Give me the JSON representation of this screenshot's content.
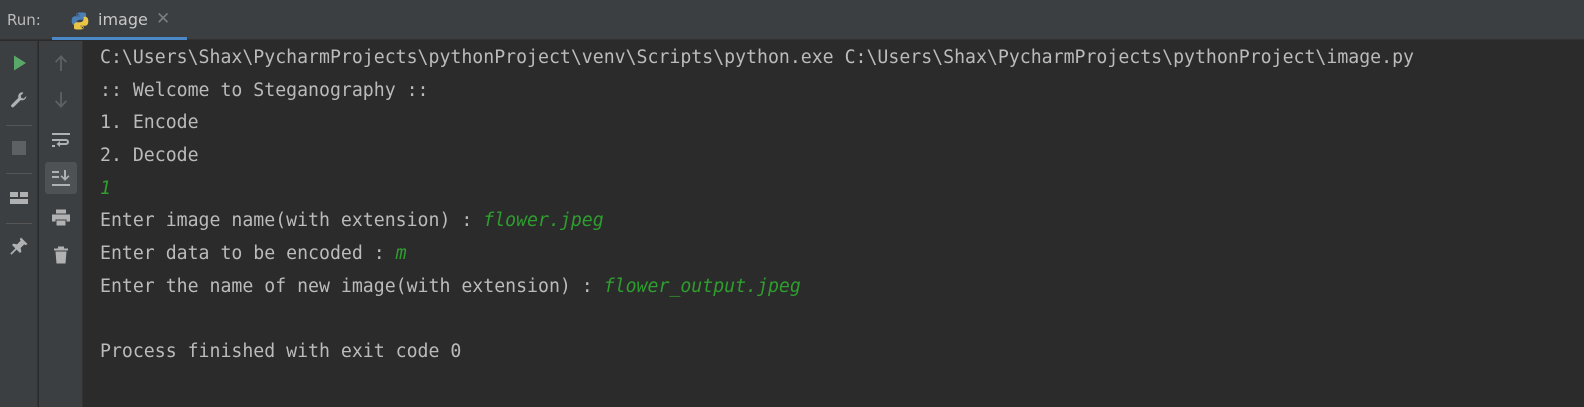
{
  "header": {
    "run_label": "Run:",
    "tab": {
      "label": "image",
      "close": "✕",
      "icon": "python-icon"
    }
  },
  "toolbar_left": [
    {
      "name": "rerun-icon"
    },
    {
      "name": "wrench-icon"
    },
    {
      "name": "stop-icon"
    },
    {
      "name": "layout-icon"
    },
    {
      "name": "pin-icon"
    }
  ],
  "toolbar_right": [
    {
      "name": "arrow-up-icon"
    },
    {
      "name": "arrow-down-icon"
    },
    {
      "name": "soft-wrap-icon"
    },
    {
      "name": "scroll-to-end-icon"
    },
    {
      "name": "print-icon"
    },
    {
      "name": "trash-icon"
    }
  ],
  "colors": {
    "background": "#2b2b2b",
    "toolbar": "#3c3f41",
    "text": "#bbbbbb",
    "user_input": "#2e9e2e",
    "run_green": "#59a869",
    "tab_underline": "#4a88c7"
  },
  "console": {
    "command": "C:\\Users\\Shax\\PycharmProjects\\pythonProject\\venv\\Scripts\\python.exe C:\\Users\\Shax\\PycharmProjects\\pythonProject\\image.py",
    "welcome": ":: Welcome to Steganography ::",
    "option1": "1. Encode",
    "option2": "2. Decode",
    "choice_input": "1",
    "prompt_image": "Enter image name(with extension) : ",
    "input_image": "flower.jpeg",
    "prompt_data": "Enter data to be encoded : ",
    "input_data": "m",
    "prompt_new": "Enter the name of new image(with extension) : ",
    "input_new": "flower_output.jpeg",
    "finished": "Process finished with exit code 0"
  }
}
